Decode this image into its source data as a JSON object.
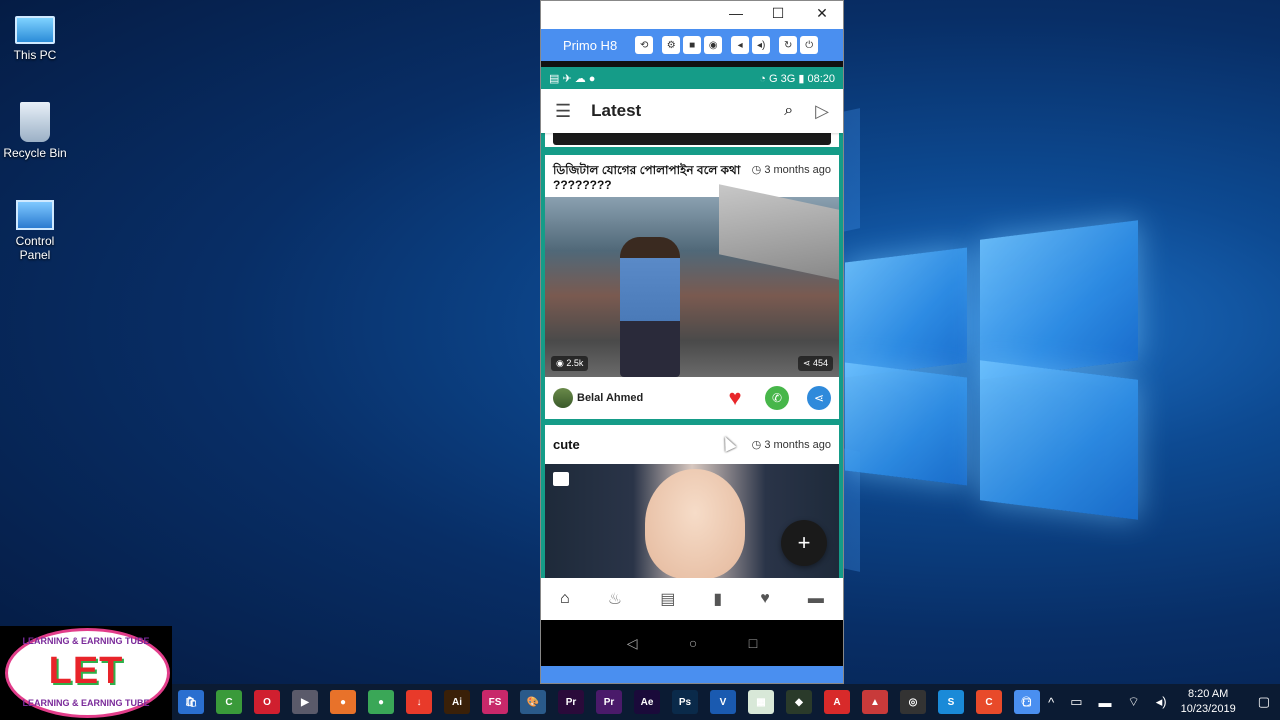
{
  "desktop": {
    "icons": [
      {
        "label": "This PC",
        "icon": "monitor-icon"
      },
      {
        "label": "Recycle Bin",
        "icon": "recycle-bin-icon"
      },
      {
        "label": "Control Panel",
        "icon": "control-panel-icon"
      }
    ]
  },
  "emulator": {
    "window_controls": {
      "minimize": "—",
      "maximize": "☐",
      "close": "✕"
    },
    "device_name": "Primo H8",
    "toolbar_icons": [
      "rotate-icon",
      "settings-icon",
      "camera-icon",
      "screenshot-icon",
      "volume-down-icon",
      "volume-up-icon",
      "refresh-icon",
      "power-icon"
    ]
  },
  "phone": {
    "status_bar": {
      "network": "G",
      "signal": "3G",
      "time": "08:20"
    },
    "app_bar": {
      "title": "Latest"
    },
    "posts": [
      {
        "title": "ডিজিটাল যোগের পোলাপাইন বলে কথা ????????",
        "time": "3 months ago",
        "views": "2.5k",
        "shares": "454",
        "author": "Belal Ahmed"
      },
      {
        "title": "cute",
        "time": "3 months ago"
      }
    ],
    "fab": "+",
    "bottom_nav": [
      "home-icon",
      "fire-icon",
      "stack-icon",
      "carousel-icon",
      "heart-icon",
      "folder-icon"
    ],
    "android_nav": {
      "back": "◁",
      "home": "○",
      "recent": "□"
    }
  },
  "taskbar": {
    "apps": [
      {
        "name": "store-icon",
        "label": "🛍",
        "color": "#2a6fd0"
      },
      {
        "name": "camtasia-icon",
        "label": "C",
        "color": "#3a9a3a"
      },
      {
        "name": "opera-icon",
        "label": "O",
        "color": "#d01f2f"
      },
      {
        "name": "video-icon",
        "label": "▶",
        "color": "#5a5a6a"
      },
      {
        "name": "firefox-icon",
        "label": "●",
        "color": "#e8722a"
      },
      {
        "name": "chrome-icon",
        "label": "●",
        "color": "#3aa757"
      },
      {
        "name": "download-icon",
        "label": "↓",
        "color": "#e83a2a"
      },
      {
        "name": "illustrator-icon",
        "label": "Ai",
        "color": "#3a2008"
      },
      {
        "name": "fs-icon",
        "label": "FS",
        "color": "#c8286a"
      },
      {
        "name": "paint-icon",
        "label": "🎨",
        "color": "#2a5a8a"
      },
      {
        "name": "premiere-icon",
        "label": "Pr",
        "color": "#2a0a3a"
      },
      {
        "name": "premiere2-icon",
        "label": "Pr",
        "color": "#4a1a6a"
      },
      {
        "name": "aftereffects-icon",
        "label": "Ae",
        "color": "#1a0a3a"
      },
      {
        "name": "photoshop-icon",
        "label": "Ps",
        "color": "#0a2a4a"
      },
      {
        "name": "visio-icon",
        "label": "V",
        "color": "#1a5ab0"
      },
      {
        "name": "excel-icon",
        "label": "▦",
        "color": "#d8e8d8"
      },
      {
        "name": "app-icon",
        "label": "◆",
        "color": "#2a3a2a"
      },
      {
        "name": "acrobat-icon",
        "label": "A",
        "color": "#d82a2a"
      },
      {
        "name": "tool-icon",
        "label": "▲",
        "color": "#c83a3a"
      },
      {
        "name": "obs-icon",
        "label": "◎",
        "color": "#333"
      },
      {
        "name": "skype-icon",
        "label": "S",
        "color": "#1a8ad8"
      },
      {
        "name": "camtasia2-icon",
        "label": "C",
        "color": "#e84a2a"
      },
      {
        "name": "primo-icon",
        "label": "▢",
        "color": "#4a8ff0"
      }
    ],
    "tray": {
      "time": "8:20 AM",
      "date": "10/23/2019"
    }
  },
  "logo": {
    "letters": "LET",
    "ring_text": "LEARNING & EARNING TUBE"
  }
}
